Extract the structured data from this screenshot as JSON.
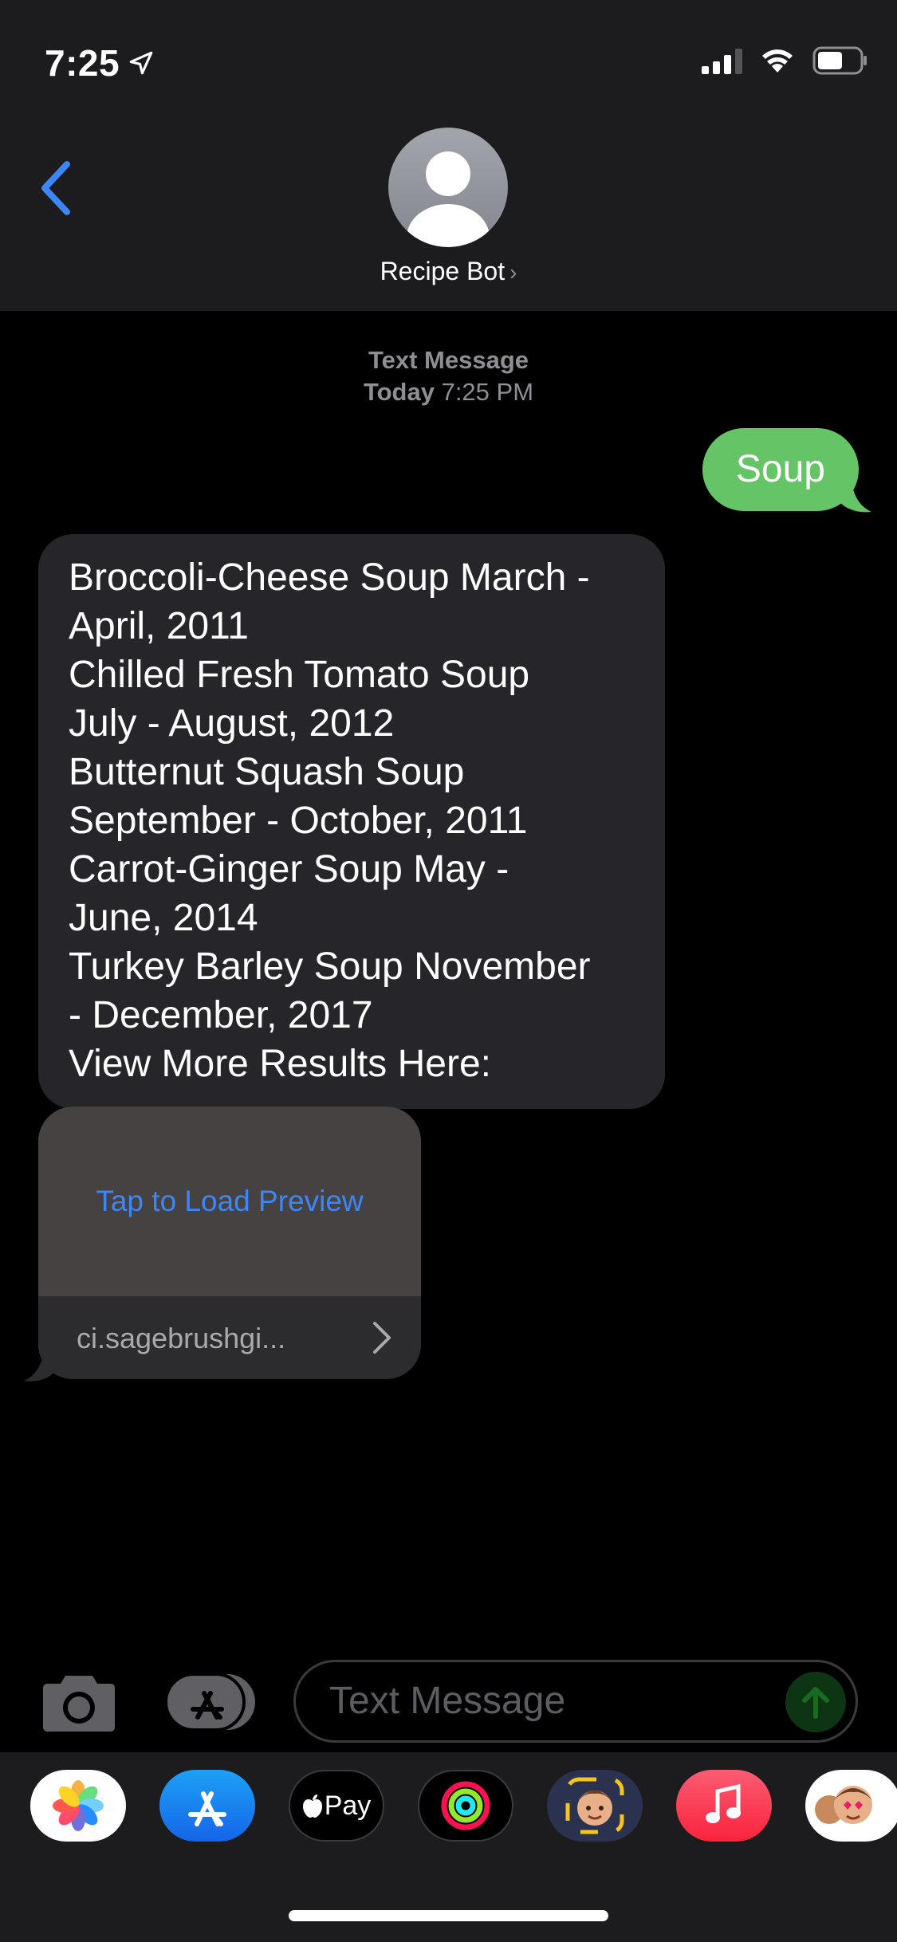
{
  "status_bar": {
    "time": "7:25",
    "location_icon": "location-arrow-icon",
    "icons": [
      "cellular-signal-icon",
      "wifi-icon",
      "battery-icon"
    ]
  },
  "header": {
    "contact_name": "Recipe Bot",
    "back_icon": "chevron-left-icon",
    "avatar_icon": "person-silhouette-icon"
  },
  "conversation": {
    "service_label": "Text Message",
    "day_label": "Today",
    "time_label": "7:25 PM",
    "sent_message": "Soup",
    "received_lines": [
      "Broccoli-Cheese Soup March -",
      "April, 2011",
      "Chilled Fresh Tomato Soup",
      "July - August, 2012",
      "Butternut Squash Soup",
      "September - October, 2011",
      "Carrot-Ginger Soup May -",
      "June, 2014",
      "Turkey Barley Soup November",
      "- December, 2017",
      "View More Results Here:"
    ],
    "link_preview": {
      "action_label": "Tap to Load Preview",
      "url": "ci.sagebrushgi..."
    }
  },
  "composer": {
    "placeholder": "Text Message"
  },
  "app_drawer": {
    "apps": [
      "photos-app-icon",
      "app-store-app-icon",
      "apple-pay-app-icon",
      "activity-app-icon",
      "memoji-camera-app-icon",
      "music-app-icon",
      "memoji-stickers-app-icon"
    ],
    "apple_pay_label": "Pay"
  },
  "colors": {
    "header_bg": "#1c1c1e",
    "sent_bubble": "#65c466",
    "received_bubble": "#26252a",
    "accent_blue": "#3d86f5",
    "secondary_text": "#8e8e93"
  }
}
